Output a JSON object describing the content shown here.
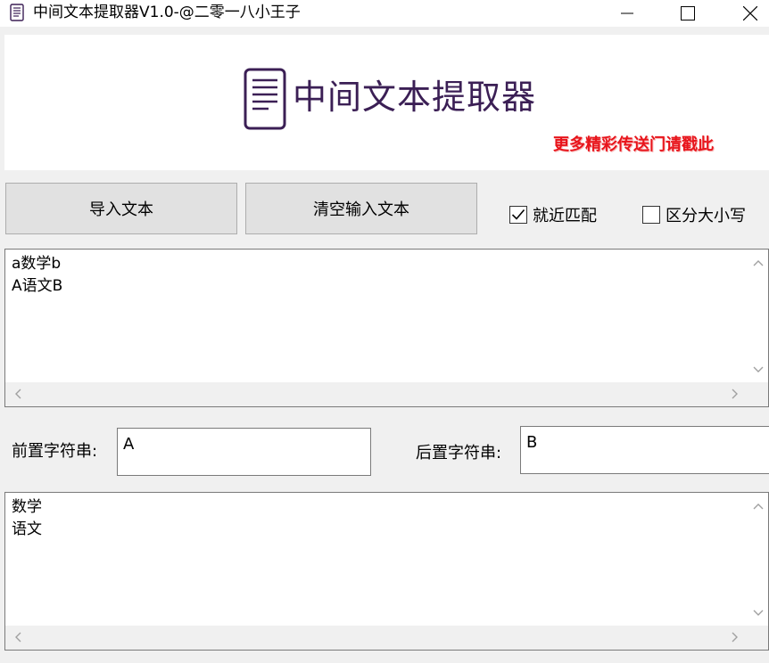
{
  "window": {
    "title": "中间文本提取器V1.0-@二零一八小王子",
    "icon": "document-icon"
  },
  "banner": {
    "logo_text": "中间文本提取器",
    "logo_icon": "document-lines-icon",
    "logo_color": "#3b1f55",
    "promo_link": "更多精彩传送门请戳此",
    "promo_color": "#e8141b"
  },
  "toolbar": {
    "import_label": "导入文本",
    "clear_label": "清空输入文本"
  },
  "options": {
    "nearby_match_label": "就近匹配",
    "nearby_match_checked": true,
    "case_sensitive_label": "区分大小写",
    "case_sensitive_checked": false
  },
  "input": {
    "text": "a数学b\nA语文B"
  },
  "delimiters": {
    "prefix_label": "前置字符串:",
    "prefix_value": "A",
    "suffix_label": "后置字符串:",
    "suffix_value": "B"
  },
  "output": {
    "text": "数学\n语文"
  }
}
